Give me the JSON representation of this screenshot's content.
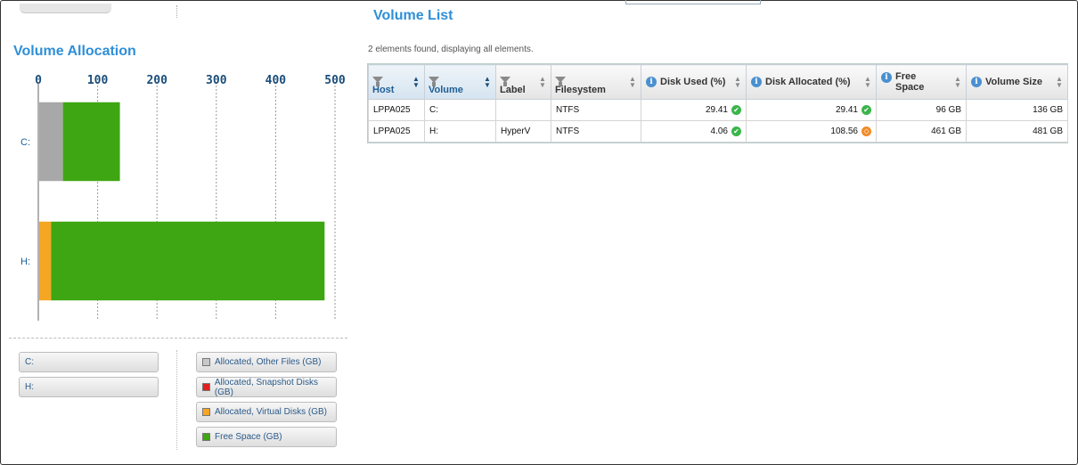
{
  "left_panel": {
    "title": "Volume Allocation",
    "legend_volumes": [
      "C:",
      "H:"
    ],
    "legend_series": [
      {
        "label": "Allocated, Other Files (GB)",
        "color": "#c8c8c8"
      },
      {
        "label": "Allocated, Snapshot Disks (GB)",
        "color": "#e02020"
      },
      {
        "label": "Allocated, Virtual Disks (GB)",
        "color": "#f5a623"
      },
      {
        "label": "Free Space (GB)",
        "color": "#3da612"
      }
    ]
  },
  "chart_data": {
    "type": "bar",
    "orientation": "horizontal",
    "stacked": true,
    "categories": [
      "C:",
      "H:"
    ],
    "x_ticks": [
      "0",
      "100",
      "200",
      "300",
      "400",
      "500"
    ],
    "xlim": [
      0,
      500
    ],
    "grid": true,
    "series": [
      {
        "name": "Allocated, Other Files (GB)",
        "color": "#a8a8a8",
        "values": [
          40,
          0
        ]
      },
      {
        "name": "Allocated, Snapshot Disks (GB)",
        "color": "#e02020",
        "values": [
          0,
          0
        ]
      },
      {
        "name": "Allocated, Virtual Disks (GB)",
        "color": "#f5a623",
        "values": [
          0,
          20
        ]
      },
      {
        "name": "Free Space (GB)",
        "color": "#3da612",
        "values": [
          96,
          461
        ]
      }
    ]
  },
  "volume_list": {
    "title": "Volume List",
    "count_text": "2 elements found, displaying all elements.",
    "columns": [
      {
        "label": "Host",
        "filter": true,
        "info": false,
        "sorted": true
      },
      {
        "label": "Volume",
        "filter": true,
        "info": false,
        "sorted": true
      },
      {
        "label": "Label",
        "filter": true,
        "info": false,
        "sorted": false
      },
      {
        "label": "Filesystem",
        "filter": true,
        "info": false,
        "sorted": false
      },
      {
        "label": "Disk Used (%)",
        "filter": false,
        "info": true,
        "sorted": false
      },
      {
        "label": "Disk Allocated (%)",
        "filter": false,
        "info": true,
        "sorted": false
      },
      {
        "label": "Free Space",
        "filter": false,
        "info": true,
        "sorted": false
      },
      {
        "label": "Volume Size",
        "filter": false,
        "info": true,
        "sorted": false
      }
    ],
    "rows": [
      {
        "host": "LPPA025",
        "volume": "C:",
        "label": "",
        "filesystem": "NTFS",
        "disk_used": "29.41",
        "disk_used_status": "ok",
        "disk_allocated": "29.41",
        "disk_allocated_status": "ok",
        "free_space": "96 GB",
        "volume_size": "136 GB"
      },
      {
        "host": "LPPA025",
        "volume": "H:",
        "label": "HyperV",
        "filesystem": "NTFS",
        "disk_used": "4.06",
        "disk_used_status": "ok",
        "disk_allocated": "108.56",
        "disk_allocated_status": "warning",
        "free_space": "461 GB",
        "volume_size": "481 GB"
      }
    ]
  }
}
